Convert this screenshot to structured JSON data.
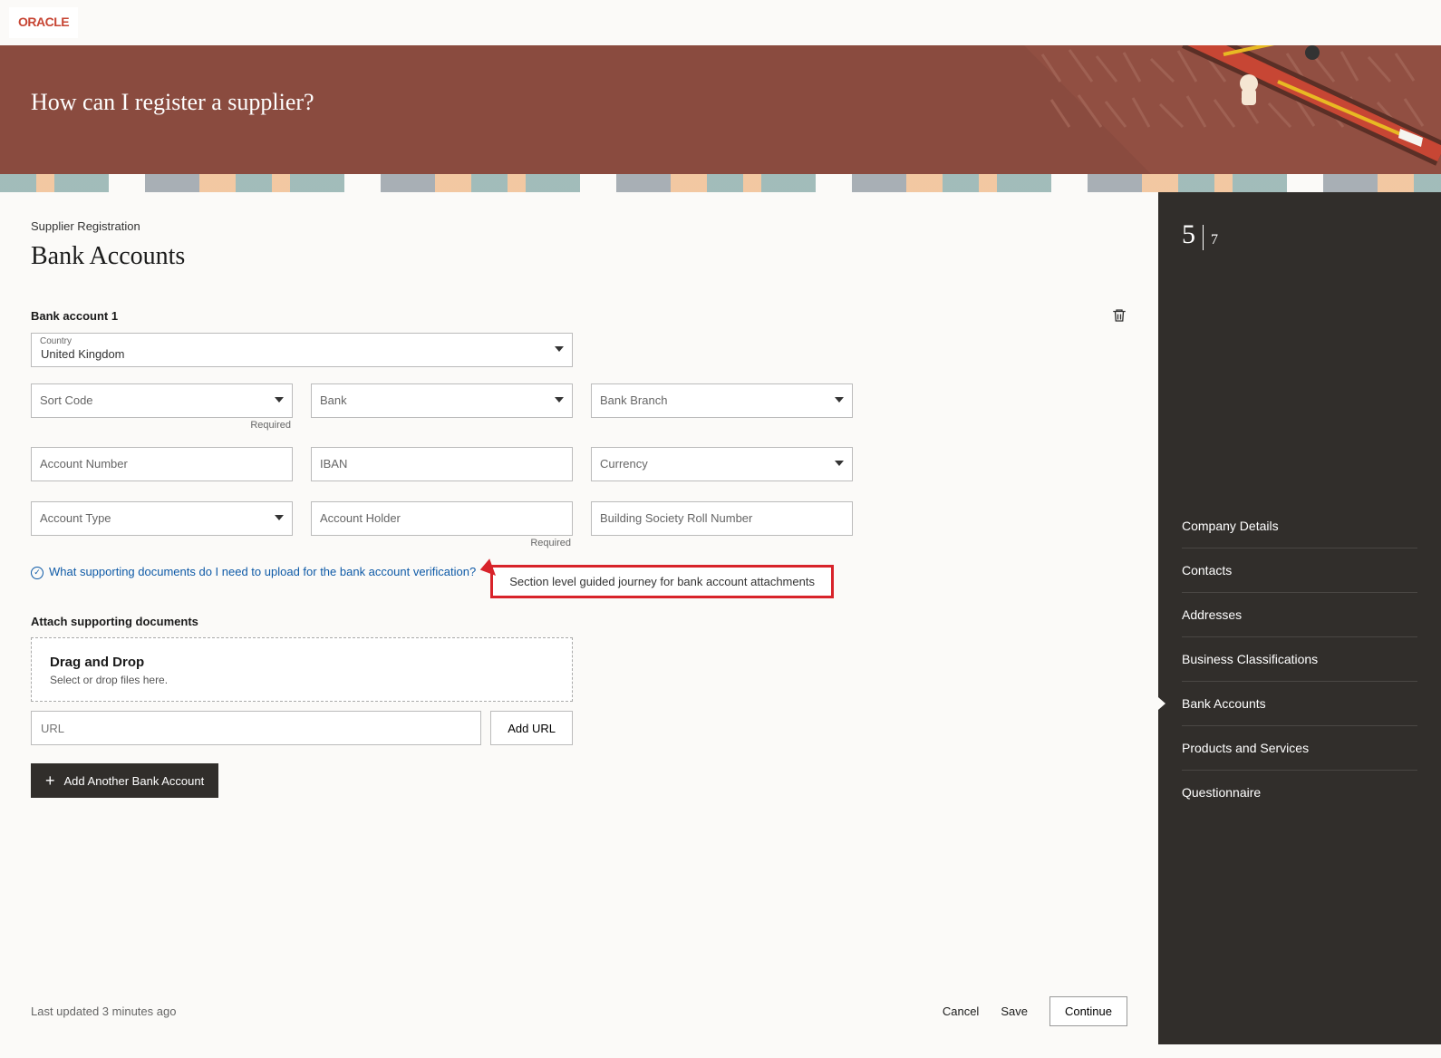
{
  "logo": "ORACLE",
  "hero_title": "How can I register a supplier?",
  "crumb": "Supplier Registration",
  "page_title": "Bank Accounts",
  "section_label": "Bank account 1",
  "required_text": "Required",
  "fields": {
    "country_label": "Country",
    "country_value": "United Kingdom",
    "sort_code": "Sort Code",
    "bank": "Bank",
    "bank_branch": "Bank Branch",
    "account_number": "Account Number",
    "iban": "IBAN",
    "currency": "Currency",
    "account_type": "Account Type",
    "account_holder": "Account Holder",
    "building_society": "Building Society Roll Number"
  },
  "help_link_text": "What supporting documents do I need to upload for the bank account verification?",
  "callout_text": "Section level guided journey for bank account attachments",
  "attach_label": "Attach supporting documents",
  "drop_title": "Drag and Drop",
  "drop_sub": "Select or drop files here.",
  "url_placeholder": "URL",
  "add_url_label": "Add URL",
  "add_account_label": "Add Another Bank Account",
  "last_updated": "Last updated 3 minutes ago",
  "footer": {
    "cancel": "Cancel",
    "save": "Save",
    "continue": "Continue"
  },
  "steps": {
    "current": "5",
    "total": "7"
  },
  "nav": [
    "Company Details",
    "Contacts",
    "Addresses",
    "Business Classifications",
    "Bank Accounts",
    "Products and Services",
    "Questionnaire"
  ],
  "active_nav_index": 4
}
